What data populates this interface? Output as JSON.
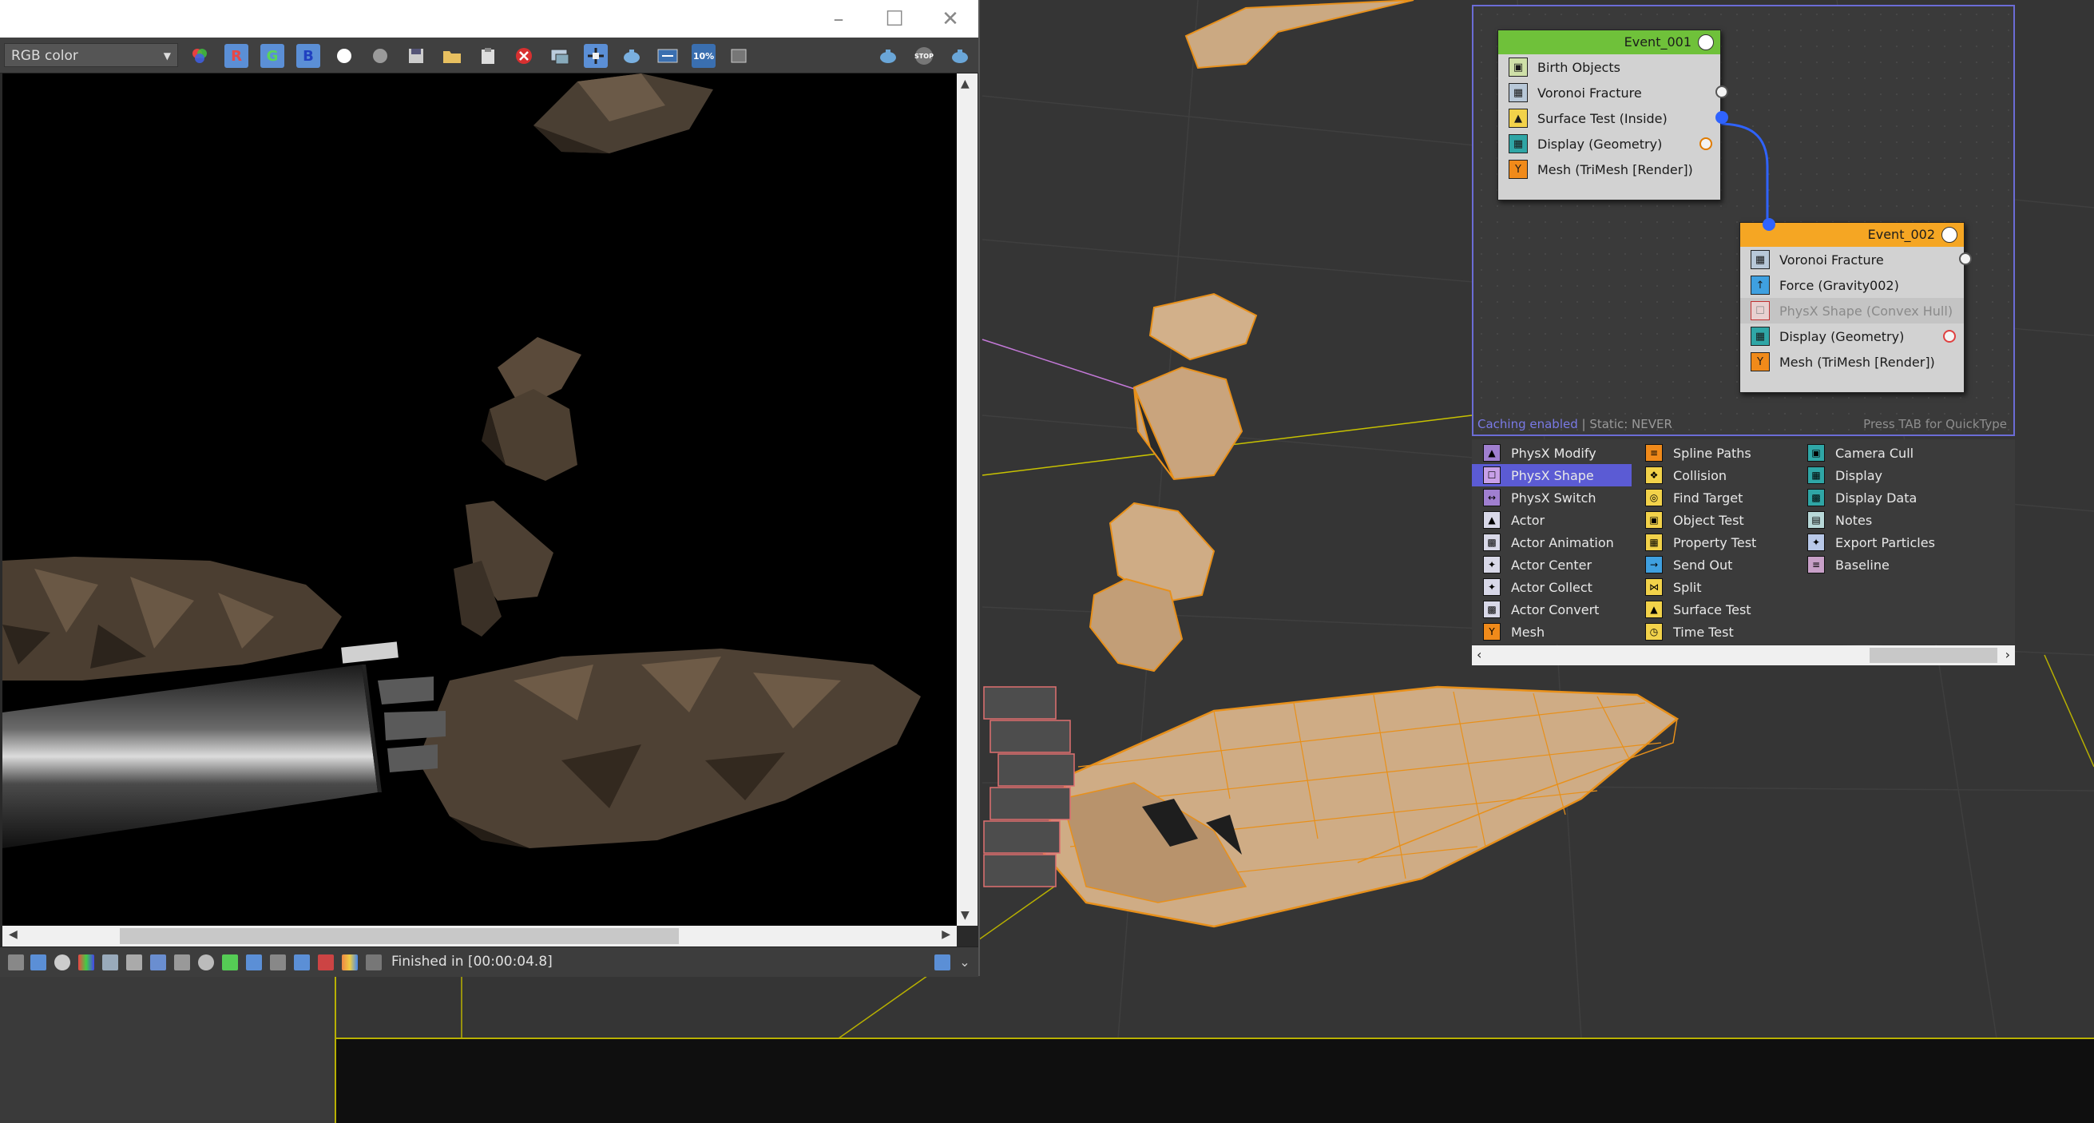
{
  "render_window": {
    "channel": "RGB color",
    "status": "Finished in [00:00:04.8]",
    "toolbar": {
      "red": "R",
      "green": "G",
      "blue": "B",
      "zoom": "10%",
      "stop": "STOP"
    }
  },
  "particle_view": {
    "event1": {
      "title": "Event_001",
      "operators": [
        "Birth Objects",
        "Voronoi Fracture",
        "Surface Test (Inside)",
        "Display (Geometry)",
        "Mesh (TriMesh [Render])"
      ]
    },
    "event2": {
      "title": "Event_002",
      "operators": [
        "Voronoi Fracture",
        "Force (Gravity002)",
        "PhysX Shape (Convex Hull)",
        "Display (Geometry)",
        "Mesh (TriMesh [Render])"
      ]
    },
    "caching": "Caching enabled",
    "static": " | Static: NEVER",
    "hint": "Press TAB for QuickType"
  },
  "depot": {
    "col1": [
      "PhysX Modify",
      "PhysX Shape",
      "PhysX Switch",
      "Actor",
      "Actor Animation",
      "Actor Center",
      "Actor Collect",
      "Actor Convert",
      "Mesh"
    ],
    "col2": [
      "Spline Paths",
      "Collision",
      "Find Target",
      "Object Test",
      "Property Test",
      "Send Out",
      "Split",
      "Surface Test",
      "Time Test"
    ],
    "col3": [
      "Camera Cull",
      "Display",
      "Display Data",
      "Notes",
      "Export Particles",
      "Baseline"
    ]
  },
  "colors": {
    "event1_header": "#6fc13a",
    "event2_header": "#f5a623",
    "wire": "#2f63ff",
    "selection": "#5b5bd4",
    "panel_border": "#6b6cd6",
    "wireframe": "#e8901a"
  }
}
